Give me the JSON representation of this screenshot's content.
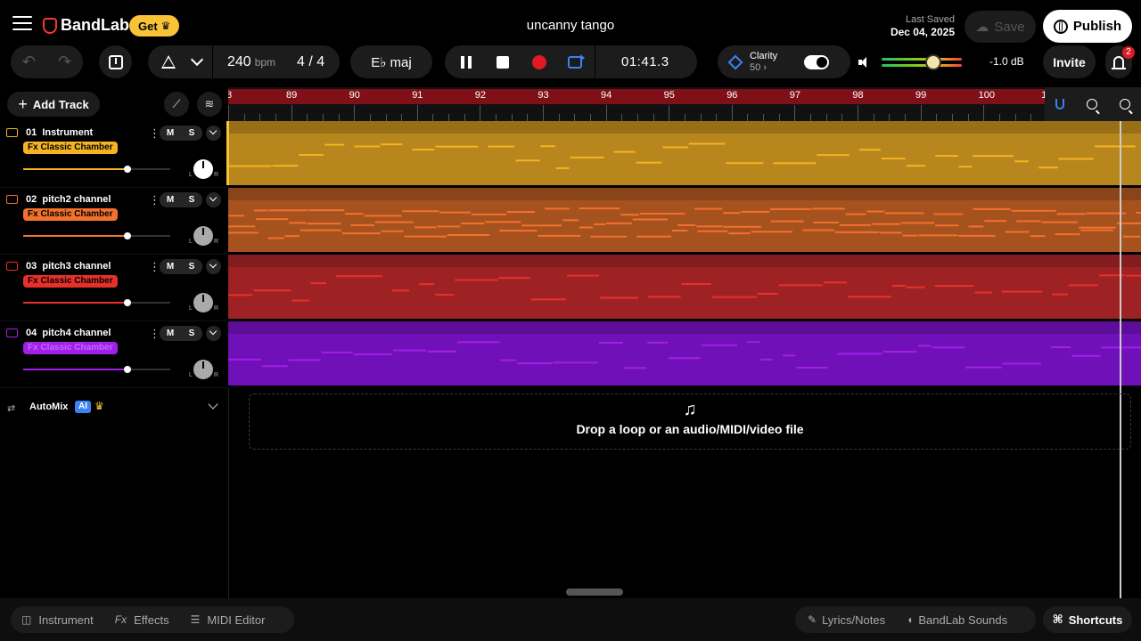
{
  "app": {
    "brand": "BandLab",
    "get_label": "Get",
    "project_title": "uncanny tango",
    "last_saved_label": "Last Saved",
    "last_saved_date": "Dec 04, 2025",
    "save_label": "Save",
    "publish_label": "Publish"
  },
  "transport": {
    "bpm_value": "240",
    "bpm_unit": "bpm",
    "time_sig": "4 / 4",
    "key": "E♭ maj",
    "time": "01:41.3",
    "clarity_label": "Clarity",
    "clarity_value": "50 ›",
    "clarity_on": true,
    "master_volume_db": "-1.0 dB",
    "master_volume_level": 0.64,
    "invite_label": "Invite",
    "notifications": "2"
  },
  "toolbar": {
    "add_track_label": "Add Track"
  },
  "ruler": {
    "start_label": "8",
    "bars": [
      "89",
      "90",
      "91",
      "92",
      "93",
      "94",
      "95",
      "96",
      "97",
      "98",
      "99",
      "100",
      "1"
    ]
  },
  "tracks": [
    {
      "number": "01",
      "name": "Instrument",
      "fx": "Fx Classic Chamber",
      "color": "#f5b324",
      "lane_color": "#b7861d",
      "volume": 0.71,
      "mute": "M",
      "solo": "S"
    },
    {
      "number": "02",
      "name": "pitch2 channel",
      "fx": "Fx Classic Chamber",
      "color": "#f2712d",
      "lane_color": "#a6521f",
      "volume": 0.71,
      "mute": "M",
      "solo": "S"
    },
    {
      "number": "03",
      "name": "pitch3 channel",
      "fx": "Fx Classic Chamber",
      "color": "#e8302b",
      "lane_color": "#9e2224",
      "volume": 0.71,
      "mute": "M",
      "solo": "S"
    },
    {
      "number": "04",
      "name": "pitch4 channel",
      "fx": "Fx Classic Chamber",
      "color": "#a020e8",
      "lane_color": "#7010b8",
      "volume": 0.71,
      "mute": "M",
      "solo": "S"
    }
  ],
  "pan_labels": {
    "left": "L",
    "right": "R"
  },
  "automix": {
    "label": "AutoMix",
    "ai_badge": "AI"
  },
  "dropzone": {
    "text": "Drop a loop or an audio/MIDI/video file"
  },
  "bottom": {
    "instrument": "Instrument",
    "effects": "Effects",
    "midi_editor": "MIDI Editor",
    "lyrics": "Lyrics/Notes",
    "sounds": "BandLab Sounds",
    "shortcuts": "Shortcuts"
  },
  "icons": {
    "menu": "hamburger-icon",
    "undo": "undo-icon",
    "redo": "redo-icon",
    "metronome": "metronome-icon",
    "record": "record-icon",
    "loop": "loop-icon",
    "snap": "magnet-icon",
    "zoom_out": "zoom-out-icon",
    "zoom_in": "zoom-in-icon"
  }
}
